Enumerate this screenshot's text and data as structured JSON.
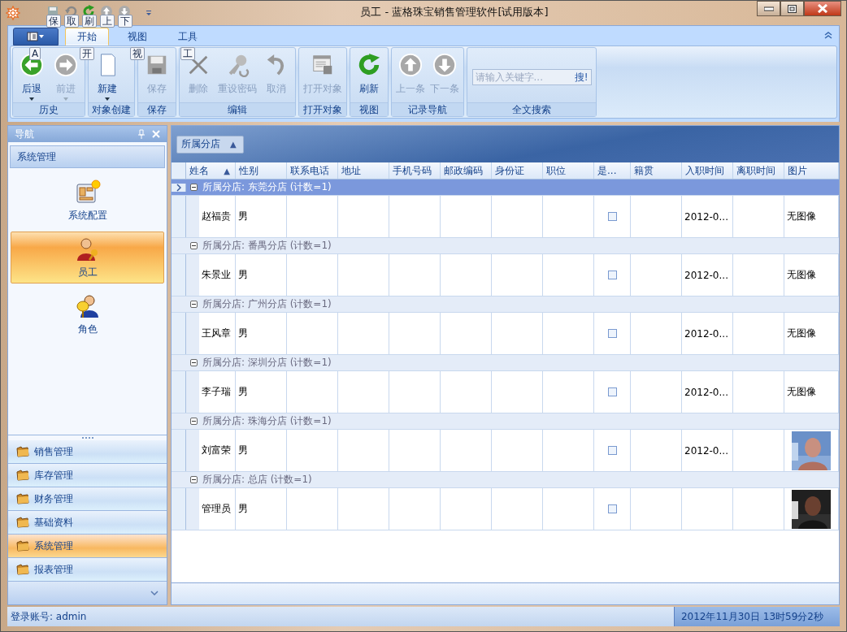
{
  "window": {
    "title": "员工 - 蓝格珠宝销售管理软件[试用版本]"
  },
  "quick_access": [
    {
      "kind": "save",
      "keytip": "保"
    },
    {
      "kind": "undo",
      "keytip": "取"
    },
    {
      "kind": "refresh",
      "keytip": "刷"
    },
    {
      "kind": "up",
      "keytip": "上"
    },
    {
      "kind": "down",
      "keytip": "下"
    }
  ],
  "ribbon": {
    "app_keytip": "A",
    "tabs": [
      {
        "label": "开始",
        "keytip": "开",
        "selected": true
      },
      {
        "label": "视图",
        "keytip": "视",
        "selected": false
      },
      {
        "label": "工具",
        "keytip": "工",
        "selected": false
      }
    ],
    "groups": [
      {
        "label": "历史",
        "buttons": [
          {
            "label": "后退",
            "kind": "back",
            "disabled": false,
            "dropdown": true
          },
          {
            "label": "前进",
            "kind": "forward",
            "disabled": true,
            "dropdown": true
          }
        ]
      },
      {
        "label": "对象创建",
        "buttons": [
          {
            "label": "新建",
            "kind": "new",
            "disabled": false,
            "dropdown": true
          }
        ]
      },
      {
        "label": "保存",
        "buttons": [
          {
            "label": "保存",
            "kind": "save",
            "disabled": true,
            "dropdown": false
          }
        ]
      },
      {
        "label": "编辑",
        "buttons": [
          {
            "label": "删除",
            "kind": "delete",
            "disabled": true,
            "dropdown": false
          },
          {
            "label": "重设密码",
            "kind": "key",
            "disabled": true,
            "dropdown": false
          },
          {
            "label": "取消",
            "kind": "undo",
            "disabled": true,
            "dropdown": false
          }
        ]
      },
      {
        "label": "打开对象",
        "buttons": [
          {
            "label": "打开对象",
            "kind": "open",
            "disabled": true,
            "dropdown": false
          }
        ]
      },
      {
        "label": "视图",
        "buttons": [
          {
            "label": "刷新",
            "kind": "refresh",
            "disabled": false,
            "dropdown": false
          }
        ]
      },
      {
        "label": "记录导航",
        "buttons": [
          {
            "label": "上一条",
            "kind": "up",
            "disabled": true,
            "dropdown": false
          },
          {
            "label": "下一条",
            "kind": "down",
            "disabled": true,
            "dropdown": false
          }
        ]
      }
    ],
    "search": {
      "label": "全文搜索",
      "placeholder": "请输入关键字...",
      "button": "搜!"
    }
  },
  "navigation": {
    "title": "导航",
    "group": "系统管理",
    "items": [
      {
        "label": "系统配置",
        "kind": "config",
        "selected": false
      },
      {
        "label": "员工",
        "kind": "employee",
        "selected": true
      },
      {
        "label": "角色",
        "kind": "role",
        "selected": false
      }
    ],
    "categories": [
      {
        "label": "销售管理",
        "selected": false
      },
      {
        "label": "库存管理",
        "selected": false
      },
      {
        "label": "财务管理",
        "selected": false
      },
      {
        "label": "基础资料",
        "selected": false
      },
      {
        "label": "系统管理",
        "selected": true
      },
      {
        "label": "报表管理",
        "selected": false
      }
    ]
  },
  "grid": {
    "group_by": {
      "label": "所属分店",
      "sort_mark": "▲"
    },
    "columns": [
      {
        "label": "姓名",
        "sort_mark": "▲"
      },
      {
        "label": "性别"
      },
      {
        "label": "联系电话"
      },
      {
        "label": "地址"
      },
      {
        "label": "手机号码"
      },
      {
        "label": "邮政编码"
      },
      {
        "label": "身份证"
      },
      {
        "label": "职位"
      },
      {
        "label": "是..."
      },
      {
        "label": "籍贯"
      },
      {
        "label": "入职时间"
      },
      {
        "label": "离职时间"
      },
      {
        "label": "图片"
      }
    ],
    "groups": [
      {
        "header": "所属分店: 东莞分店 (计数=1)",
        "focused": true,
        "rows": [
          {
            "name": "赵福贵",
            "gender": "男",
            "checked": false,
            "hire_date": "2012-0...",
            "photo": "无图像"
          }
        ]
      },
      {
        "header": "所属分店: 番禺分店 (计数=1)",
        "focused": false,
        "rows": [
          {
            "name": "朱景业",
            "gender": "男",
            "checked": false,
            "hire_date": "2012-0...",
            "photo": "无图像"
          }
        ]
      },
      {
        "header": "所属分店: 广州分店 (计数=1)",
        "focused": false,
        "rows": [
          {
            "name": "王风章",
            "gender": "男",
            "checked": false,
            "hire_date": "2012-0...",
            "photo": "无图像"
          }
        ]
      },
      {
        "header": "所属分店: 深圳分店 (计数=1)",
        "focused": false,
        "rows": [
          {
            "name": "李子瑞",
            "gender": "男",
            "checked": false,
            "hire_date": "2012-0...",
            "photo": "无图像"
          }
        ]
      },
      {
        "header": "所属分店: 珠海分店 (计数=1)",
        "focused": false,
        "rows": [
          {
            "name": "刘富荣",
            "gender": "男",
            "checked": false,
            "hire_date": "2012-0..."
          }
        ]
      },
      {
        "header": "所属分店: 总店 (计数=1)",
        "focused": false,
        "rows": [
          {
            "name": "管理员",
            "gender": "男",
            "checked": false
          }
        ]
      }
    ]
  },
  "status_bar": {
    "account": "登录账号: admin",
    "datetime": "2012年11月30日 13时59分2秒"
  }
}
